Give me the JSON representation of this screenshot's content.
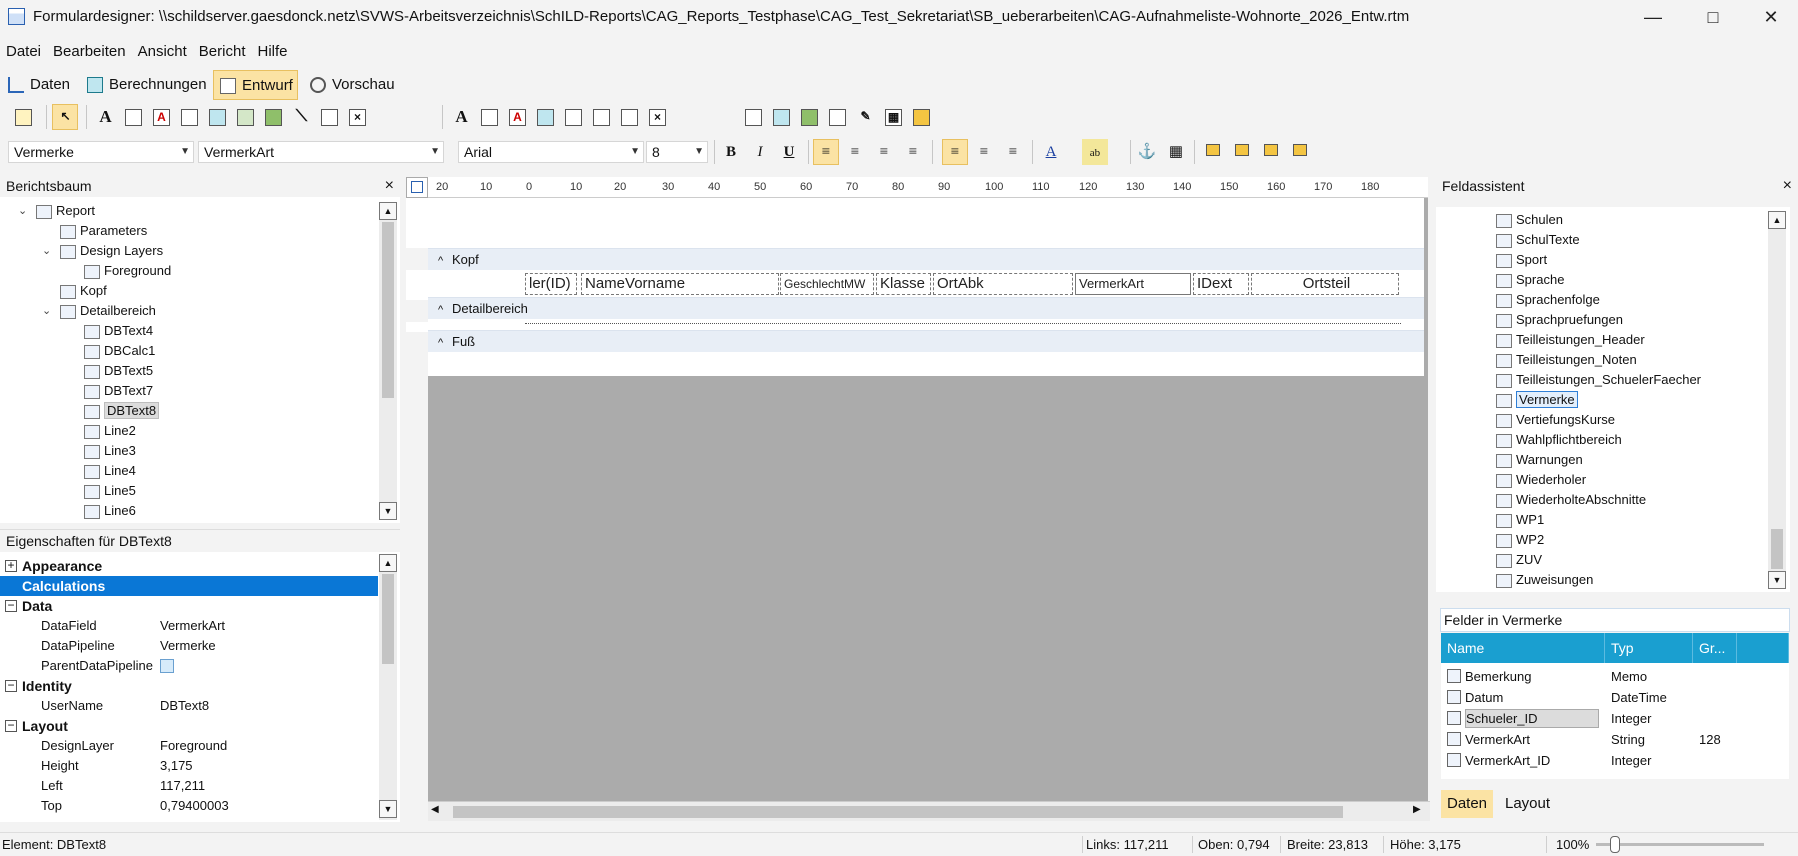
{
  "window": {
    "title": "Formulardesigner: \\\\schildserver.gaesdonck.netz\\SVWS-Arbeitsverzeichnis\\SchILD-Reports\\CAG_Reports_Testphase\\CAG_Test_Sekretariat\\SB_ueberarbeiten\\CAG-Aufnahmeliste-Wohnorte_2026_Entw.rtm"
  },
  "menu": [
    "Datei",
    "Bearbeiten",
    "Ansicht",
    "Bericht",
    "Hilfe"
  ],
  "modes": [
    {
      "label": "Daten",
      "icon": "data-tree-icon"
    },
    {
      "label": "Berechnungen",
      "icon": "calculator-icon"
    },
    {
      "label": "Entwurf",
      "icon": "design-pencil-icon",
      "active": true
    },
    {
      "label": "Vorschau",
      "icon": "preview-magnifier-icon"
    }
  ],
  "format": {
    "pipeline": "Vermerke",
    "field": "VermerkArt",
    "font": "Arial",
    "size": "8",
    "bold": "B",
    "italic": "I",
    "underline": "U"
  },
  "tree_panel": {
    "title": "Berichtsbaum",
    "close": "×",
    "nodes": [
      {
        "label": "Report",
        "level": 0,
        "expand": "v",
        "icon": "report-icon"
      },
      {
        "label": "Parameters",
        "level": 1,
        "icon": "parameters-icon"
      },
      {
        "label": "Design Layers",
        "level": 1,
        "expand": "v",
        "icon": "layers-icon"
      },
      {
        "label": "Foreground",
        "level": 2,
        "icon": "layer-icon"
      },
      {
        "label": "Kopf",
        "level": 1,
        "icon": "band-icon"
      },
      {
        "label": "Detailbereich",
        "level": 1,
        "expand": "v",
        "icon": "band-icon"
      },
      {
        "label": "DBText4",
        "level": 2,
        "icon": "dbtext-icon"
      },
      {
        "label": "DBCalc1",
        "level": 2,
        "icon": "dbcalc-icon"
      },
      {
        "label": "DBText5",
        "level": 2,
        "icon": "dbtext-icon"
      },
      {
        "label": "DBText7",
        "level": 2,
        "icon": "dbtext-icon"
      },
      {
        "label": "DBText8",
        "level": 2,
        "icon": "dbtext-icon",
        "selected": true
      },
      {
        "label": "Line2",
        "level": 2,
        "icon": "line-icon"
      },
      {
        "label": "Line3",
        "level": 2,
        "icon": "line-icon"
      },
      {
        "label": "Line4",
        "level": 2,
        "icon": "line-icon"
      },
      {
        "label": "Line5",
        "level": 2,
        "icon": "line-icon"
      },
      {
        "label": "Line6",
        "level": 2,
        "icon": "line-icon"
      }
    ]
  },
  "props_panel": {
    "title": "Eigenschaften für DBText8",
    "rows": [
      {
        "type": "cat",
        "box": "+",
        "label": "Appearance"
      },
      {
        "type": "cat",
        "label": "Calculations",
        "highlight": true
      },
      {
        "type": "cat",
        "box": "−",
        "label": "Data"
      },
      {
        "type": "prop",
        "key": "DataField",
        "value": "VermerkArt"
      },
      {
        "type": "prop",
        "key": "DataPipeline",
        "value": "Vermerke"
      },
      {
        "type": "prop",
        "key": "ParentDataPipeline",
        "value": ""
      },
      {
        "type": "cat",
        "box": "−",
        "label": "Identity"
      },
      {
        "type": "prop",
        "key": "UserName",
        "value": "DBText8"
      },
      {
        "type": "cat",
        "box": "−",
        "label": "Layout"
      },
      {
        "type": "prop",
        "key": "DesignLayer",
        "value": "Foreground"
      },
      {
        "type": "prop",
        "key": "Height",
        "value": "3,175"
      },
      {
        "type": "prop",
        "key": "Left",
        "value": "117,211"
      },
      {
        "type": "prop",
        "key": "Top",
        "value": "0,79400003"
      }
    ]
  },
  "ruler": [
    "20",
    "10",
    "0",
    "10",
    "20",
    "30",
    "40",
    "50",
    "60",
    "70",
    "80",
    "90",
    "100",
    "110",
    "120",
    "130",
    "140",
    "150",
    "160",
    "170",
    "180"
  ],
  "bands": {
    "kopf": "Kopf",
    "detail": "Detailbereich",
    "fuss": "Fuß",
    "caret": "^"
  },
  "kopf_fields": [
    "ler(ID)",
    "NameVorname",
    "GeschlechtMW",
    "Klasse",
    "OrtAbk",
    "VermerkArt",
    "IDext",
    "Ortsteil"
  ],
  "field_assistant": {
    "title": "Feldassistent",
    "close": "×",
    "tables": [
      "Schulen",
      "SchulTexte",
      "Sport",
      "Sprache",
      "Sprachenfolge",
      "Sprachpruefungen",
      "Teilleistungen_Header",
      "Teilleistungen_Noten",
      "Teilleistungen_SchuelerFaecher",
      "Vermerke",
      "VertiefungsKurse",
      "Wahlpflichtbereich",
      "Warnungen",
      "Wiederholer",
      "WiederholteAbschnitte",
      "WP1",
      "WP2",
      "ZUV",
      "Zuweisungen"
    ],
    "selected_table": "Vermerke",
    "fields_title": "Felder in Vermerke",
    "columns": [
      "Name",
      "Typ",
      "Gr..."
    ],
    "fields": [
      {
        "name": "Bemerkung",
        "type": "Memo",
        "size": ""
      },
      {
        "name": "Datum",
        "type": "DateTime",
        "size": ""
      },
      {
        "name": "Schueler_ID",
        "type": "Integer",
        "size": "",
        "selected": true
      },
      {
        "name": "VermerkArt",
        "type": "String",
        "size": "128"
      },
      {
        "name": "VermerkArt_ID",
        "type": "Integer",
        "size": ""
      }
    ],
    "tabs": [
      "Daten",
      "Layout"
    ]
  },
  "status": {
    "element": "Element: DBText8",
    "links": "Links: 117,211",
    "oben": "Oben: 0,794",
    "breite": "Breite: 23,813",
    "hoehe": "Höhe: 3,175",
    "zoom": "100%"
  }
}
